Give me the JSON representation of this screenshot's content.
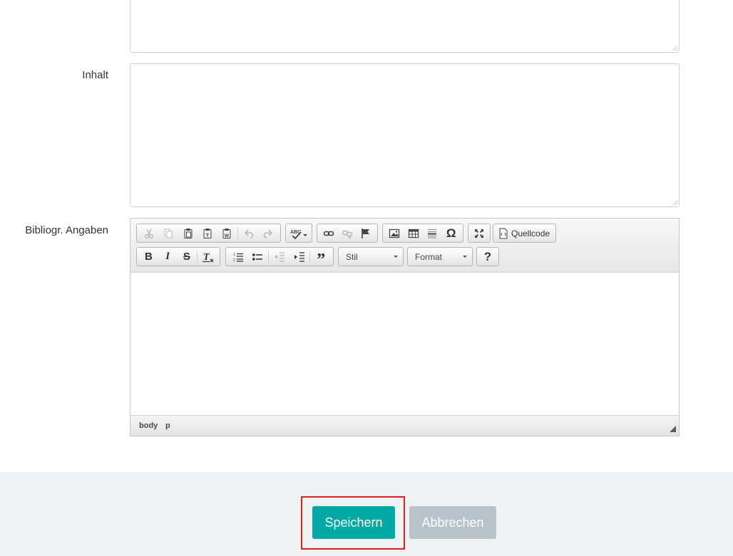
{
  "form": {
    "label_inhalt": "Inhalt",
    "label_bibliogr": "Bibliogr. Angaben",
    "inhalt_value": "",
    "top_field_value": ""
  },
  "editor": {
    "toolbar_row1": [
      {
        "icon": "cut-icon",
        "disabled": true
      },
      {
        "icon": "copy-icon",
        "disabled": true
      },
      {
        "icon": "paste-icon",
        "disabled": false
      },
      {
        "icon": "paste-text-icon",
        "disabled": false
      },
      {
        "icon": "paste-word-icon",
        "disabled": false
      },
      {
        "icon": "undo-icon",
        "disabled": true
      },
      {
        "icon": "redo-icon",
        "disabled": true
      },
      {
        "icon": "spellcheck-icon",
        "disabled": false
      },
      {
        "icon": "link-icon",
        "disabled": false
      },
      {
        "icon": "unlink-icon",
        "disabled": true
      },
      {
        "icon": "anchor-icon",
        "disabled": false
      },
      {
        "icon": "image-icon",
        "disabled": false
      },
      {
        "icon": "table-icon",
        "disabled": false
      },
      {
        "icon": "horizontal-rule-icon",
        "disabled": false
      },
      {
        "icon": "special-char-icon",
        "disabled": false
      },
      {
        "icon": "maximize-icon",
        "disabled": false
      }
    ],
    "source_label": "Quellcode",
    "style_combo": "Stil",
    "format_combo": "Format",
    "help_label": "?",
    "path_body": "body",
    "path_p": "p",
    "accent_color": "#00a9a6"
  },
  "actions": {
    "save_label": "Speichern",
    "cancel_label": "Abbrechen",
    "save_color": "#00a9a6",
    "cancel_color": "#b8c2c9",
    "highlight_color": "#e01e1e"
  }
}
